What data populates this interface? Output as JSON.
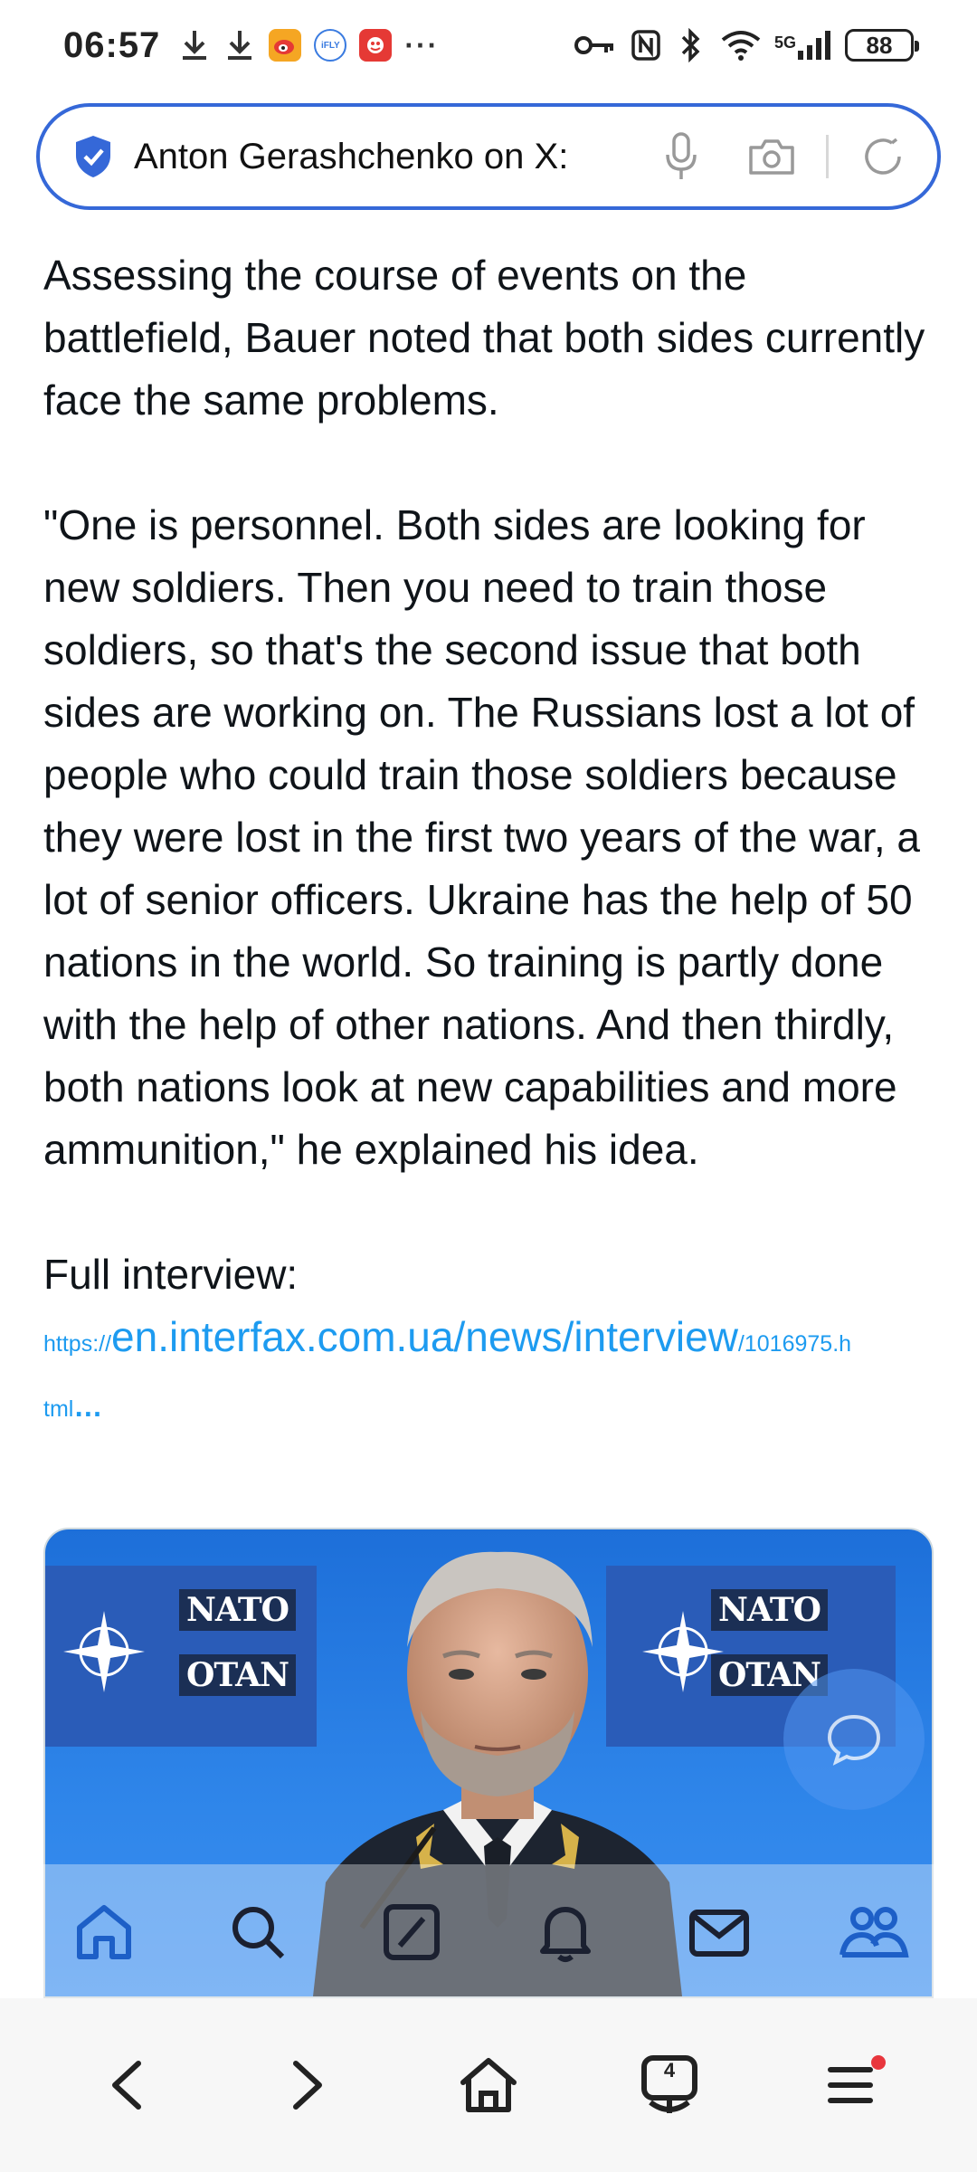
{
  "status_bar": {
    "time": "06:57",
    "left_icons": [
      "download-icon",
      "download-icon",
      "weibo-app-icon",
      "ifly-app-icon",
      "red-app-icon"
    ],
    "ifly_label": "iFLY",
    "more": "···",
    "network": "5G",
    "battery": "88"
  },
  "address_bar": {
    "title": "Anton Gerashchenko on X:",
    "accent": "#3568d8"
  },
  "article": {
    "paragraph_1": "Assessing the course of events on the battlefield, Bauer noted that both sides currently face the same problems.",
    "paragraph_2": "\"One is personnel. Both sides are looking for new soldiers. Then you need to train those soldiers, so that's the second issue that both sides are working on. The Russians lost a lot of people who could train those soldiers because they were lost in the first two years of the war, a lot of senior officers. Ukraine has the help of 50 nations in the world. So training is partly done with the help of other nations. And then thirdly, both nations look at new capabilities and more ammunition,\" he explained his idea.",
    "full_interview_label": "Full interview:",
    "link": {
      "scheme": "https://",
      "main": "en.interfax.com.ua/news/interview",
      "rest": "/1016975.h",
      "tail": "tml",
      "ellipsis": "…",
      "color": "#1d9bf0"
    }
  },
  "image": {
    "flag_text_top": "NATO",
    "flag_text_bottom": "OTAN"
  },
  "x_nav": {
    "items": [
      "home-icon",
      "search-icon",
      "grok-icon",
      "notifications-icon",
      "messages-icon",
      "communities-icon"
    ]
  },
  "browser_bar": {
    "items": [
      "back-icon",
      "forward-icon",
      "home-icon",
      "tabs-icon",
      "menu-icon"
    ],
    "tabs_count": "4"
  }
}
